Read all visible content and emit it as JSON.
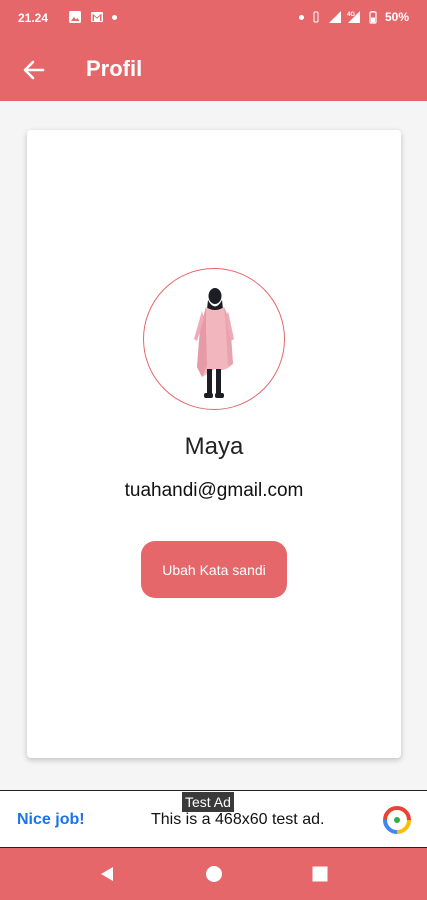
{
  "status_bar": {
    "time": "21.24",
    "battery": "50%",
    "network": "4G"
  },
  "app_bar": {
    "title": "Profil",
    "back_icon": "arrow-left-icon"
  },
  "profile": {
    "name": "Maya",
    "email": "tuahandi@gmail.com",
    "change_password_label": "Ubah Kata sandi"
  },
  "ad": {
    "tag": "Test Ad",
    "headline": "Nice job!",
    "text": "This is a 468x60 test ad."
  },
  "colors": {
    "primary": "#e5676a",
    "ad_link": "#1a73e8"
  },
  "nav_bar": {
    "icons": [
      "back-triangle-icon",
      "home-circle-icon",
      "recents-square-icon"
    ]
  }
}
